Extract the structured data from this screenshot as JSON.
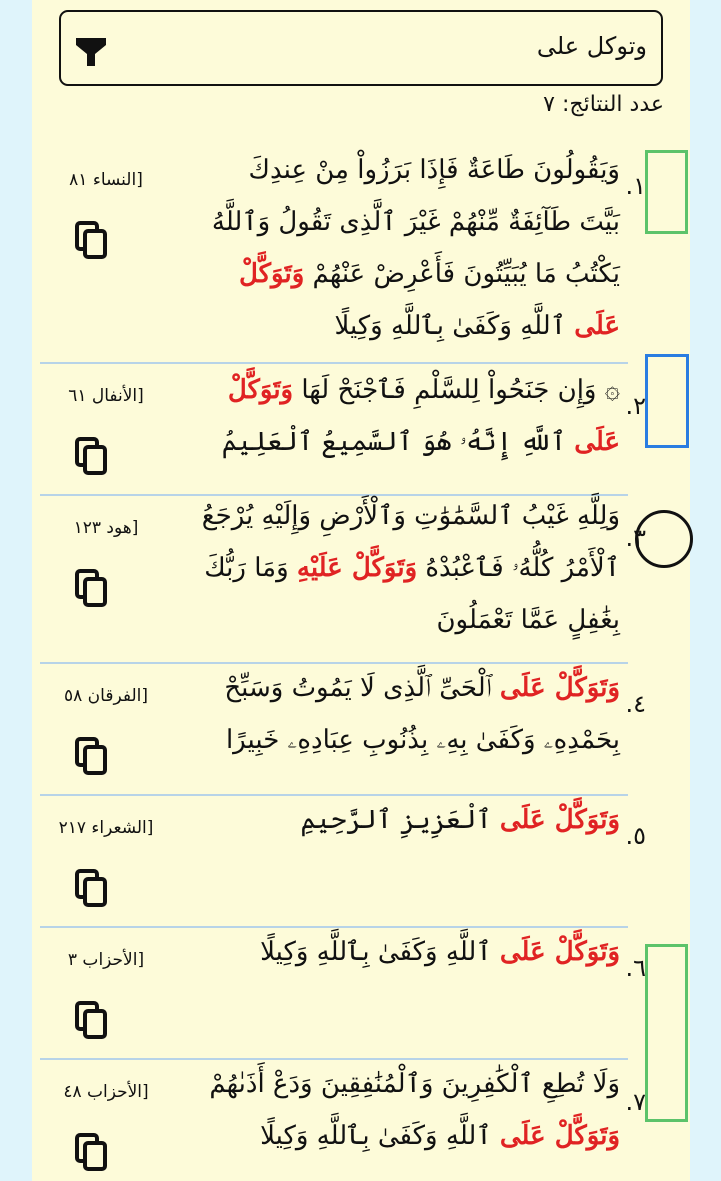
{
  "search": {
    "query": "وتوكل على"
  },
  "results_count_label": "عدد النتائج: ٧",
  "results": [
    {
      "number": "١.",
      "reference": "[النساء ٨١",
      "parts": [
        {
          "t": "وَيَقُولُونَ طَاعَةٌ فَإِذَا بَرَزُواْ مِنْ عِندِكَ بَيَّتَ طَآئِفَةٌ مِّنْهُمْ غَيْرَ ٱلَّذِى تَقُولُ وَٱللَّهُ يَكْتُبُ مَا يُبَيِّتُونَ فَأَعْرِضْ عَنْهُمْ ",
          "hl": false
        },
        {
          "t": "وَتَوَكَّلْ عَلَى",
          "hl": true
        },
        {
          "t": " ٱللَّهِ وَكَفَىٰ بِٱللَّهِ وَكِيلًا",
          "hl": false
        }
      ]
    },
    {
      "number": "٢.",
      "reference": "[الأنفال ٦١",
      "parts": [
        {
          "t": "۞ وَإِن جَنَحُواْ لِلسَّلْمِ فَٱجْنَحْ لَهَا ",
          "hl": false
        },
        {
          "t": "وَتَوَكَّلْ عَلَى",
          "hl": true
        },
        {
          "t": " ٱللَّهِ إِنَّهُۥ هُوَ ٱلسَّمِيعُ ٱلْعَلِيمُ",
          "hl": false
        }
      ]
    },
    {
      "number": "٣.",
      "reference": "[هود ١٢٣",
      "parts": [
        {
          "t": "وَلِلَّهِ غَيْبُ ٱلسَّمَٰوَٰتِ وَٱلْأَرْضِ وَإِلَيْهِ يُرْجَعُ ٱلْأَمْرُ كُلُّهُۥ فَٱعْبُدْهُ ",
          "hl": false
        },
        {
          "t": "وَتَوَكَّلْ عَلَيْهِ",
          "hl": true
        },
        {
          "t": " وَمَا رَبُّكَ بِغَٰفِلٍ عَمَّا تَعْمَلُونَ",
          "hl": false
        }
      ]
    },
    {
      "number": "٤.",
      "reference": "[الفرقان ٥٨",
      "parts": [
        {
          "t": "وَتَوَكَّلْ عَلَى",
          "hl": true
        },
        {
          "t": " ٱلْحَىِّ ٱلَّذِى لَا يَمُوتُ وَسَبِّحْ بِحَمْدِهِۦ وَكَفَىٰ بِهِۦ بِذُنُوبِ عِبَادِهِۦ خَبِيرًا",
          "hl": false
        }
      ]
    },
    {
      "number": "٥.",
      "reference": "[الشعراء ٢١٧",
      "parts": [
        {
          "t": "وَتَوَكَّلْ عَلَى",
          "hl": true
        },
        {
          "t": " ٱلْعَزِيزِ ٱلرَّحِيمِ",
          "hl": false
        }
      ]
    },
    {
      "number": "٦.",
      "reference": "[الأحزاب ٣",
      "parts": [
        {
          "t": "وَتَوَكَّلْ عَلَى",
          "hl": true
        },
        {
          "t": " ٱللَّهِ وَكَفَىٰ بِٱللَّهِ وَكِيلًا",
          "hl": false
        }
      ]
    },
    {
      "number": "٧.",
      "reference": "[الأحزاب ٤٨",
      "parts": [
        {
          "t": "وَلَا تُطِعِ ٱلْكَٰفِرِينَ وَٱلْمُنَٰفِقِينَ وَدَعْ أَذَىٰهُمْ ",
          "hl": false
        },
        {
          "t": "وَتَوَكَّلْ عَلَى",
          "hl": true
        },
        {
          "t": " ٱللَّهِ وَكَفَىٰ بِٱللَّهِ وَكِيلًا",
          "hl": false
        }
      ]
    }
  ],
  "icons": {
    "filter": "filter-icon",
    "copy": "copy-icon"
  },
  "colors": {
    "highlight": "#e02323",
    "green_box": "#5cc36a",
    "blue_box": "#2a7de1"
  }
}
